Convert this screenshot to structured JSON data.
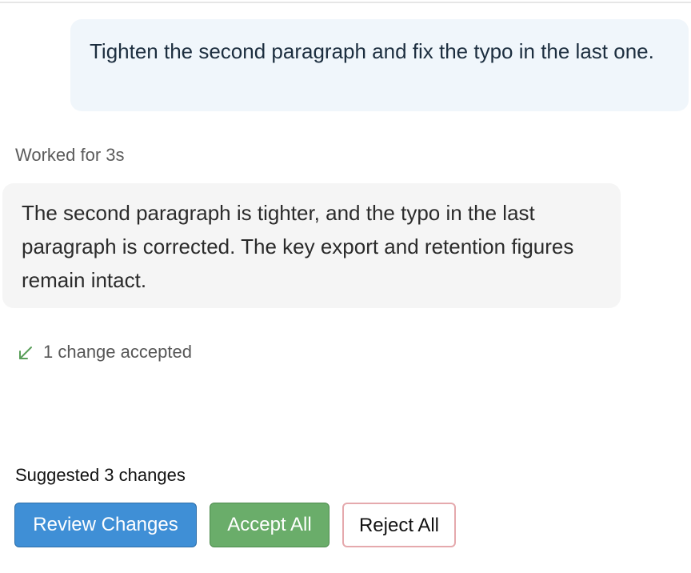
{
  "conversation": {
    "user_message": "Tighten the second paragraph and fix the typo in the last one.",
    "worked_label": "Worked for 3s",
    "assistant_message": "The second paragraph is tighter, and the typo in the last paragraph is corrected. The key export and retention figures remain intact."
  },
  "changes": {
    "accepted_icon": "arrow-down-left-icon",
    "accepted_text": "1 change accepted",
    "suggested_text": "Suggested 3 changes"
  },
  "actions": {
    "review_label": "Review Changes",
    "accept_all_label": "Accept All",
    "reject_all_label": "Reject All"
  },
  "colors": {
    "user_bubble_bg": "#f0f6fb",
    "assistant_bubble_bg": "#f5f5f5",
    "review_button": "#3f8fd6",
    "accept_button": "#6aad6a",
    "reject_border": "#e5a9ad",
    "accepted_icon": "#5a9f5a"
  }
}
